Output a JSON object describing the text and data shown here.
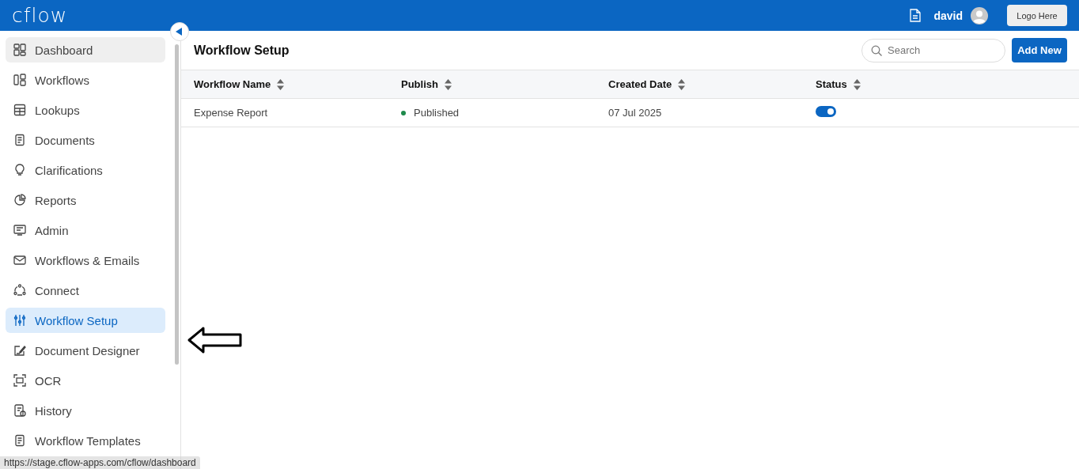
{
  "header": {
    "logo": "cflow",
    "user": "david",
    "logo_button": "Logo Here"
  },
  "sidebar": {
    "items": [
      {
        "label": "Dashboard",
        "selected": false,
        "hovered": true
      },
      {
        "label": "Workflows",
        "selected": false,
        "hovered": false
      },
      {
        "label": "Lookups",
        "selected": false,
        "hovered": false
      },
      {
        "label": "Documents",
        "selected": false,
        "hovered": false
      },
      {
        "label": "Clarifications",
        "selected": false,
        "hovered": false
      },
      {
        "label": "Reports",
        "selected": false,
        "hovered": false
      },
      {
        "label": "Admin",
        "selected": false,
        "hovered": false
      },
      {
        "label": "Workflows & Emails",
        "selected": false,
        "hovered": false
      },
      {
        "label": "Connect",
        "selected": false,
        "hovered": false
      },
      {
        "label": "Workflow Setup",
        "selected": true,
        "hovered": false
      },
      {
        "label": "Document Designer",
        "selected": false,
        "hovered": false
      },
      {
        "label": "OCR",
        "selected": false,
        "hovered": false
      },
      {
        "label": "History",
        "selected": false,
        "hovered": false
      },
      {
        "label": "Workflow Templates",
        "selected": false,
        "hovered": false
      }
    ]
  },
  "page": {
    "title": "Workflow Setup",
    "search": {
      "placeholder": "Search"
    },
    "add_button": "Add New"
  },
  "table": {
    "columns": [
      "Workflow Name",
      "Publish",
      "Created Date",
      "Status"
    ],
    "rows": [
      {
        "name": "Expense Report",
        "publish": "Published",
        "color": "#1e8a4c",
        "created": "07 Jul 2025",
        "on": true
      }
    ]
  },
  "status_link": "https://stage.cflow-apps.com/cflow/dashboard"
}
